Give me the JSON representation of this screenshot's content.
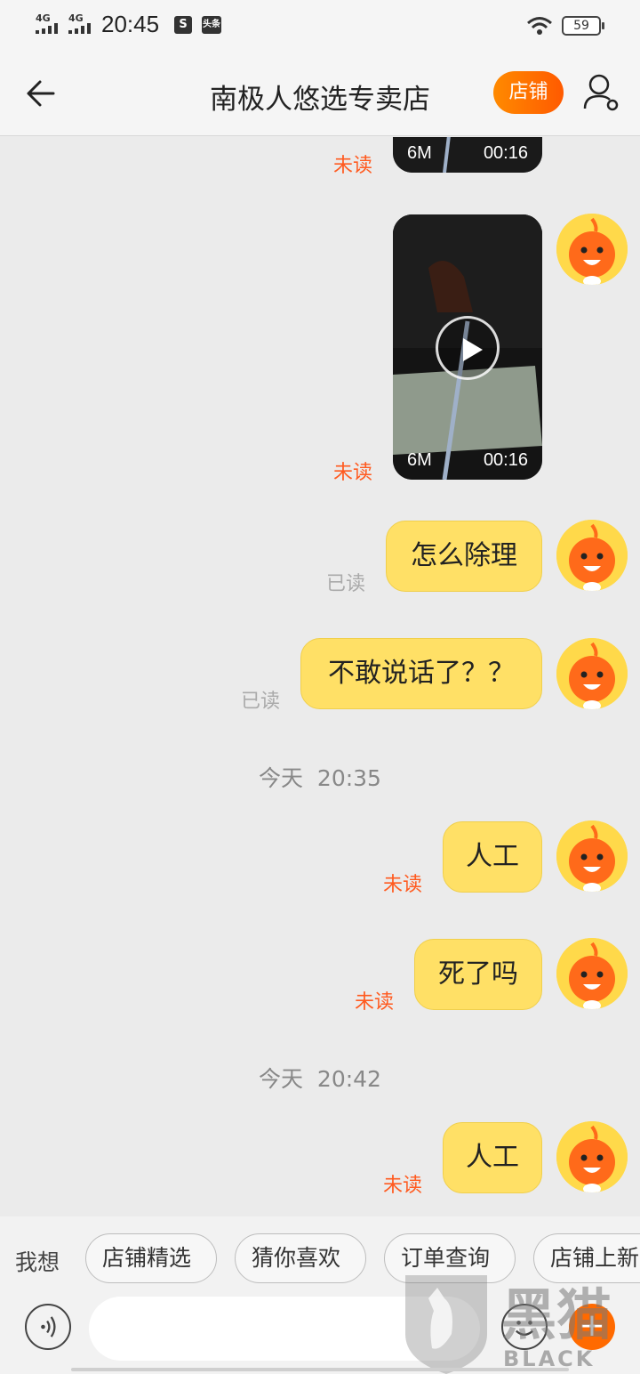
{
  "status_bar": {
    "network1": "4G",
    "network2": "4G",
    "time": "20:45",
    "app_icon_1": "S",
    "app_icon_2": "头条",
    "battery": "59"
  },
  "nav": {
    "title": "南极人悠选专卖店",
    "shop_button": "店铺"
  },
  "chat": {
    "video_partial": {
      "size": "6M",
      "duration": "00:16",
      "status": "未读"
    },
    "video": {
      "size": "6M",
      "duration": "00:16",
      "status": "未读"
    },
    "messages": [
      {
        "text": "怎么除理",
        "status": "已读"
      },
      {
        "text": "不敢说话了？？",
        "status": "已读"
      }
    ],
    "timestamp_1": "今天  20:35",
    "messages_2": [
      {
        "text": "人工",
        "status": "未读"
      },
      {
        "text": "死了吗",
        "status": "未读"
      }
    ],
    "timestamp_2": "今天  20:42",
    "messages_3": [
      {
        "text": "人工",
        "status": "未读"
      }
    ]
  },
  "quick_replies": {
    "label": "我想",
    "chips": [
      "店铺精选",
      "猜你喜欢",
      "订单查询",
      "店铺上新"
    ]
  },
  "input_bar": {
    "placeholder": "",
    "icons": [
      "voice-icon",
      "emoji-icon",
      "plus-icon"
    ]
  },
  "watermark": {
    "cn": "黑猫",
    "en": "BLACK CAT"
  },
  "colors": {
    "accent": "#ff6a00",
    "bubble": "#ffe066",
    "unread": "#ff5a1f",
    "read": "#aaaaaa",
    "avatar_bg": "#ffd94a"
  }
}
